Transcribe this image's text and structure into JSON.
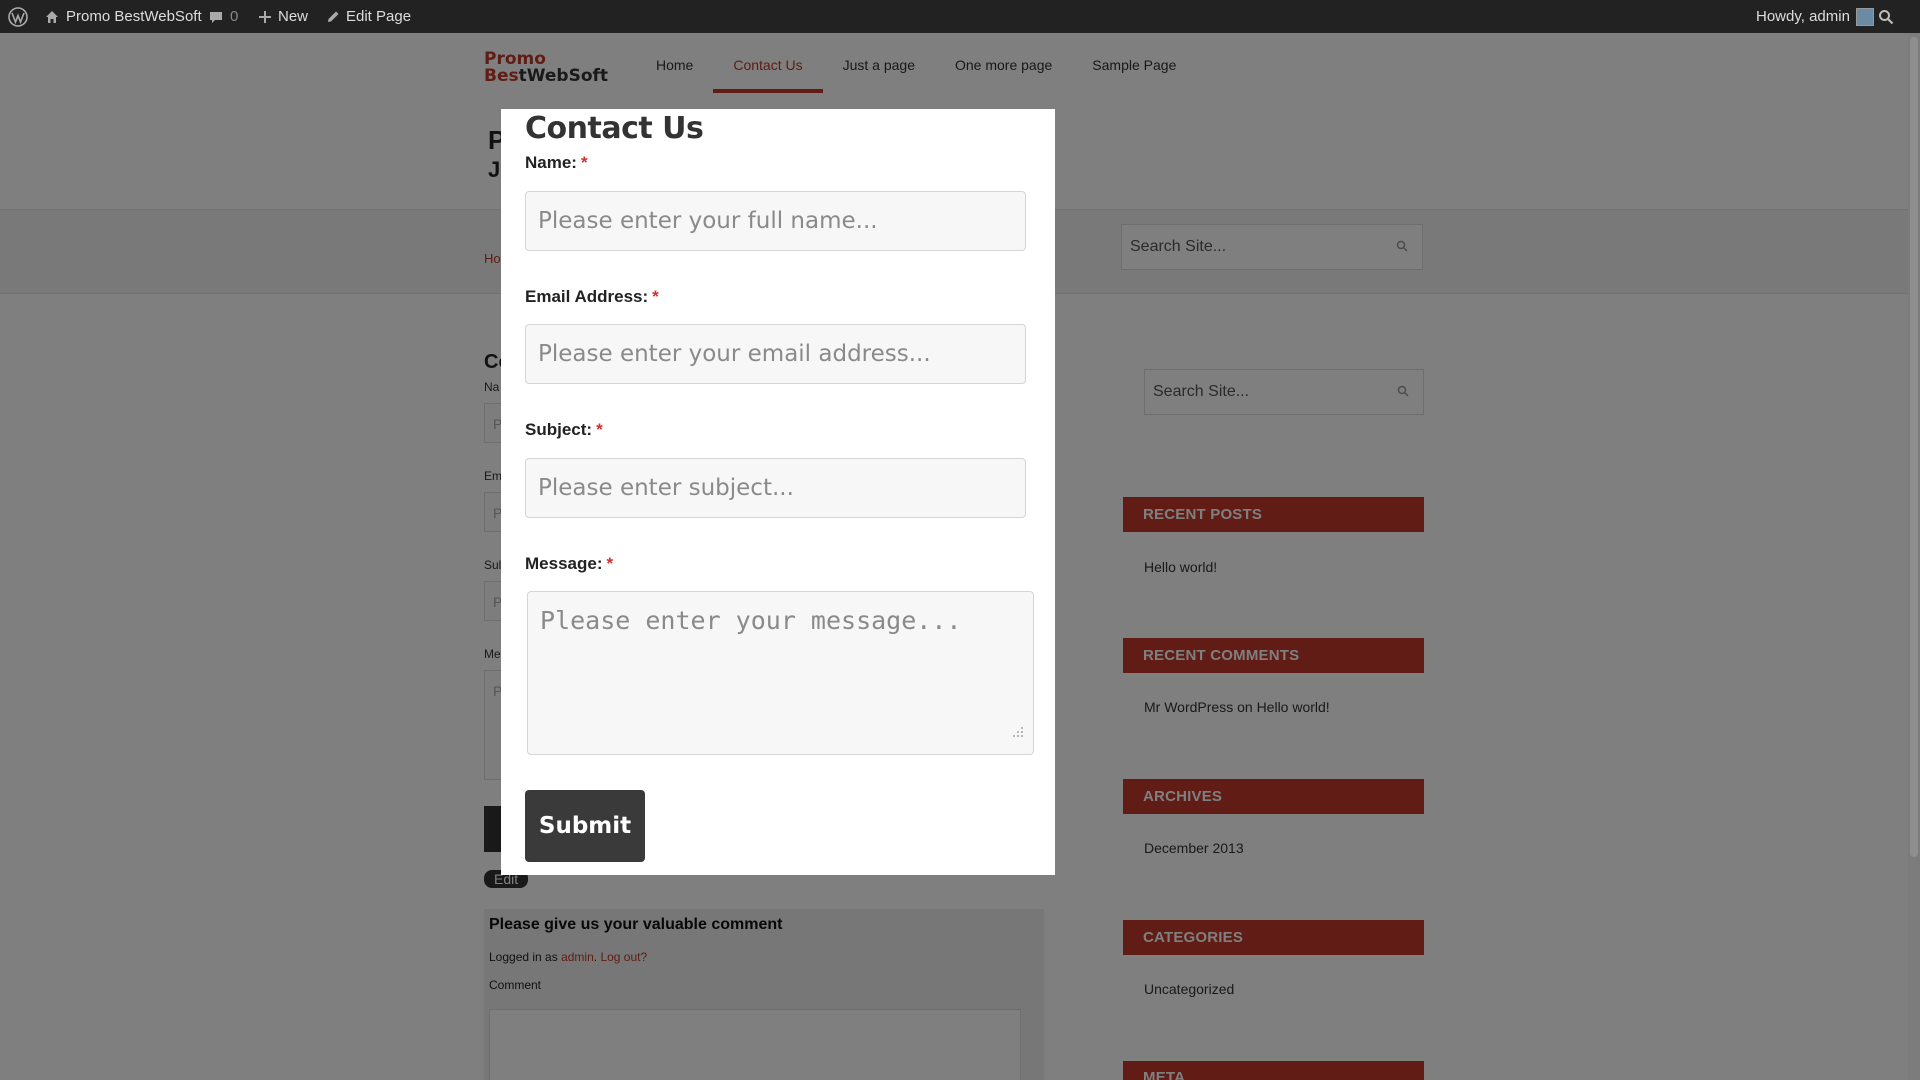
{
  "admin_bar": {
    "site_name": "Promo BestWebSoft",
    "comments_count": "0",
    "new_label": "New",
    "edit_label": "Edit Page",
    "greeting": "Howdy, admin"
  },
  "site": {
    "logo_line1": "Promo",
    "logo_line2_accent": "Bes",
    "logo_line2_rest": "tWebSoft",
    "nav": [
      {
        "label": "Home"
      },
      {
        "label": "Contact Us"
      },
      {
        "label": "Just a page"
      },
      {
        "label": "One more page"
      },
      {
        "label": "Sample Page"
      }
    ],
    "active_nav": "Contact Us",
    "header_text_a": "P",
    "header_text_b": "J",
    "breadcrumb_partial": "Ho",
    "search_placeholder": "Search Site...",
    "bg_form": {
      "title_partial": "Co",
      "label_name": "Na",
      "label_email": "Em",
      "label_subject": "Sul",
      "label_message": "Me",
      "input_placeholder_partial": "P",
      "edit_label": "Edit"
    },
    "comment_section": {
      "title": "Please give us your valuable comment",
      "logged_in_prefix": "Logged in as",
      "user_link": "admin",
      "logout_link": "Log out?",
      "comment_label": "Comment"
    }
  },
  "sidebar": {
    "widgets": [
      {
        "title": "RECENT POSTS",
        "items": [
          "Hello world!"
        ]
      },
      {
        "title": "RECENT COMMENTS",
        "author": "Mr WordPress",
        "on": "on",
        "post": "Hello world!"
      },
      {
        "title": "ARCHIVES",
        "items": [
          "December 2013"
        ]
      },
      {
        "title": "CATEGORIES",
        "items": [
          "Uncategorized"
        ]
      },
      {
        "title": "META"
      }
    ]
  },
  "modal": {
    "title": "Contact Us",
    "required_mark": "*",
    "fields": {
      "name": {
        "label": "Name:",
        "placeholder": "Please enter your full name..."
      },
      "email": {
        "label": "Email Address:",
        "placeholder": "Please enter your email address..."
      },
      "subject": {
        "label": "Subject:",
        "placeholder": "Please enter subject..."
      },
      "message": {
        "label": "Message:",
        "placeholder": "Please enter your message..."
      }
    },
    "submit_label": "Submit"
  },
  "colors": {
    "accent": "#c0392b",
    "admin_bar": "#222222",
    "button": "#3a3a3a",
    "required": "#d32f2f"
  }
}
